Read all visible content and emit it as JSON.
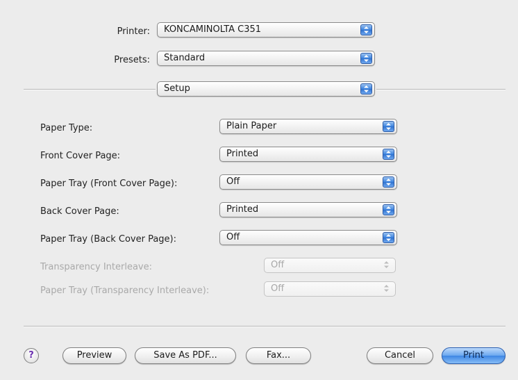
{
  "header": {
    "printer_label": "Printer:",
    "printer_value": "KONCAMINOLTA C351",
    "presets_label": "Presets:",
    "presets_value": "Standard",
    "panel_value": "Setup"
  },
  "settings": [
    {
      "label": "Paper Type:",
      "value": "Plain Paper",
      "enabled": true
    },
    {
      "label": "Front Cover Page:",
      "value": "Printed",
      "enabled": true
    },
    {
      "label": "Paper Tray (Front Cover Page):",
      "value": "Off",
      "enabled": true
    },
    {
      "label": "Back Cover Page:",
      "value": "Printed",
      "enabled": true
    },
    {
      "label": "Paper Tray (Back Cover Page):",
      "value": "Off",
      "enabled": true
    },
    {
      "label": "Transparency Interleave:",
      "value": "Off",
      "enabled": false
    },
    {
      "label": "Paper Tray (Transparency Interleave):",
      "value": "Off",
      "enabled": false
    }
  ],
  "footer": {
    "help": "?",
    "preview": "Preview",
    "save_pdf": "Save As PDF...",
    "fax": "Fax...",
    "cancel": "Cancel",
    "print": "Print"
  },
  "colors": {
    "accent": "#3f86e4",
    "help_glyph": "#6b2fb0",
    "background": "#ececec"
  }
}
